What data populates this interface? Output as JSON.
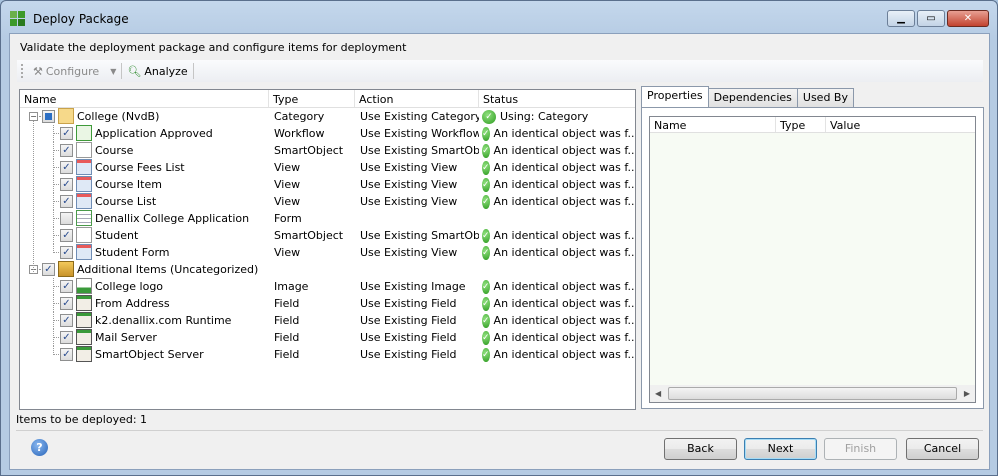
{
  "window": {
    "title": "Deploy Package",
    "minimize": "▁",
    "maximize": "▭",
    "close": "✕"
  },
  "subtitle": "Validate the deployment package and configure items for deployment",
  "toolbar": {
    "configure": "Configure",
    "analyze": "Analyze"
  },
  "tree": {
    "columns": [
      "Name",
      "Type",
      "Action",
      "Status"
    ],
    "rows": [
      {
        "name": "College (NvdB)",
        "type": "Category",
        "action": "Use Existing Category",
        "status": "Using: Category",
        "level": 0,
        "check": "partial",
        "icon": "folder",
        "expand": true
      },
      {
        "name": "Application Approved",
        "type": "Workflow",
        "action": "Use Existing Workflow",
        "status": "An identical object was f...",
        "level": 1,
        "check": "checked",
        "icon": "workflow"
      },
      {
        "name": "Course",
        "type": "SmartObject",
        "action": "Use Existing SmartOb...",
        "status": "An identical object was f...",
        "level": 1,
        "check": "checked",
        "icon": "smartobject"
      },
      {
        "name": "Course Fees List",
        "type": "View",
        "action": "Use Existing View",
        "status": "An identical object was f...",
        "level": 1,
        "check": "checked",
        "icon": "view"
      },
      {
        "name": "Course Item",
        "type": "View",
        "action": "Use Existing View",
        "status": "An identical object was f...",
        "level": 1,
        "check": "checked",
        "icon": "view"
      },
      {
        "name": "Course List",
        "type": "View",
        "action": "Use Existing View",
        "status": "An identical object was f...",
        "level": 1,
        "check": "checked",
        "icon": "view"
      },
      {
        "name": "Denallix College Application",
        "type": "Form",
        "action": "",
        "status": "",
        "level": 1,
        "check": "unchecked",
        "icon": "form"
      },
      {
        "name": "Student",
        "type": "SmartObject",
        "action": "Use Existing SmartOb...",
        "status": "An identical object was f...",
        "level": 1,
        "check": "checked",
        "icon": "smartobject"
      },
      {
        "name": "Student Form",
        "type": "View",
        "action": "Use Existing View",
        "status": "An identical object was f...",
        "level": 1,
        "check": "checked",
        "icon": "view",
        "last": true
      },
      {
        "name": "Additional Items (Uncategorized)",
        "type": "",
        "action": "",
        "status": "",
        "level": 0,
        "check": "checked",
        "icon": "box",
        "expand": true
      },
      {
        "name": "College logo",
        "type": "Image",
        "action": "Use Existing Image",
        "status": "An identical object was f...",
        "level": 1,
        "check": "checked",
        "icon": "image"
      },
      {
        "name": "From Address",
        "type": "Field",
        "action": "Use Existing Field",
        "status": "An identical object was f...",
        "level": 1,
        "check": "checked",
        "icon": "field"
      },
      {
        "name": "k2.denallix.com Runtime",
        "type": "Field",
        "action": "Use Existing Field",
        "status": "An identical object was f...",
        "level": 1,
        "check": "checked",
        "icon": "field"
      },
      {
        "name": "Mail Server",
        "type": "Field",
        "action": "Use Existing Field",
        "status": "An identical object was f...",
        "level": 1,
        "check": "checked",
        "icon": "field"
      },
      {
        "name": "SmartObject Server",
        "type": "Field",
        "action": "Use Existing Field",
        "status": "An identical object was f...",
        "level": 1,
        "check": "checked",
        "icon": "field",
        "last": true
      }
    ]
  },
  "tabs": [
    "Properties",
    "Dependencies",
    "Used By"
  ],
  "properties": {
    "columns": [
      "Name",
      "Type",
      "Value"
    ]
  },
  "status_text": "Items to be deployed: 1",
  "buttons": {
    "help": "?",
    "back": "Back",
    "next": "Next",
    "finish": "Finish",
    "cancel": "Cancel"
  }
}
